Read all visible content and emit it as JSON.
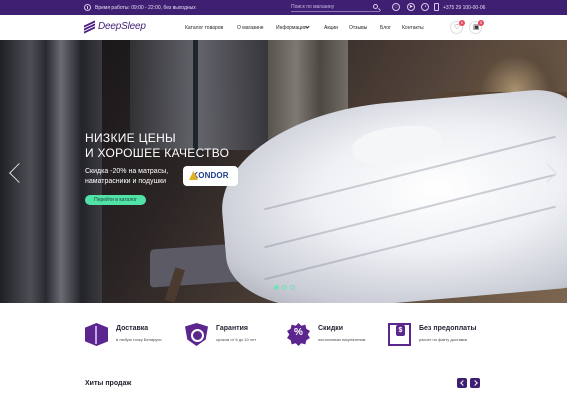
{
  "topbar": {
    "hours_text": "Время работы: 09:00 - 22:00, без выходных",
    "search_placeholder": "Поиск по магазину",
    "phone": "+375 29 100-00-06",
    "icons": [
      "clock-icon",
      "search-icon",
      "viber-icon",
      "telegram-icon",
      "whatsapp-icon",
      "phone-icon"
    ]
  },
  "header": {
    "logo": "DeepSleep",
    "nav": [
      "Каталог товаров",
      "О магазине",
      "Информация",
      "Акции",
      "Отзывы",
      "Блог",
      "Контакты"
    ],
    "favorites_count": "0",
    "cart_count": "0"
  },
  "hero": {
    "title": "НИЗКИЕ ЦЕНЫ\nИ ХОРОШЕЕ КАЧЕСТВО",
    "subtitle": "Скидка -20% на матрасы,\nнаматрасники и подушки",
    "brand_logo": "KONDOR",
    "cta": "Перейти в каталог",
    "slider": {
      "slides": 3,
      "active": 1
    }
  },
  "features": [
    {
      "title": "Доставка",
      "text": "в любую точку Беларуси",
      "icon": "box-icon"
    },
    {
      "title": "Гарантия",
      "text": "сроком от 5 до 10 лет",
      "icon": "shield-clock-icon"
    },
    {
      "title": "Скидки",
      "text": "постоянным покупателям",
      "icon": "percent-badge-icon"
    },
    {
      "title": "Без предоплаты",
      "text": "расчет по факту доставки",
      "icon": "cash-icon"
    }
  ],
  "hits": {
    "title": "Хиты продаж"
  },
  "colors": {
    "brand_purple": "#3f1f72",
    "accent_green": "#51e2a8",
    "feature_purple": "#5b278f"
  }
}
